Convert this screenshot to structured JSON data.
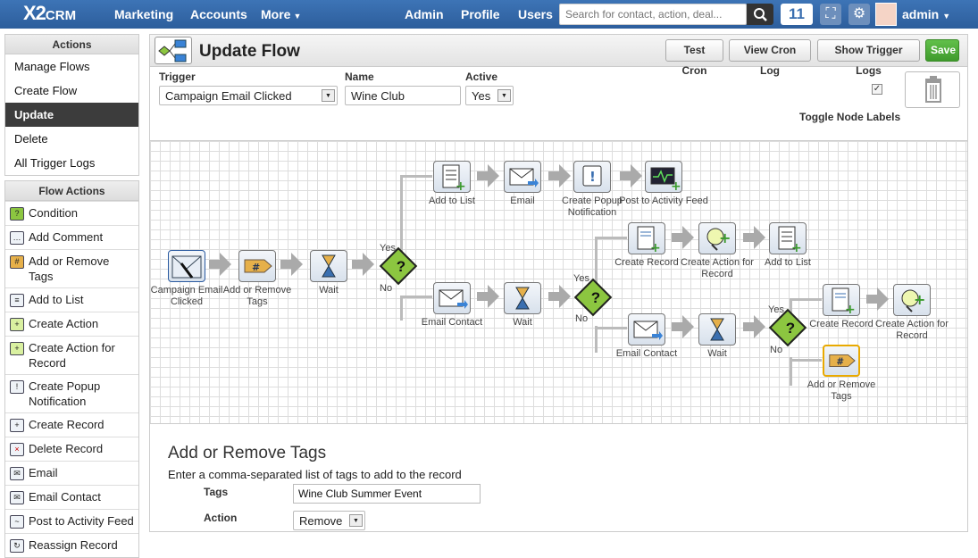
{
  "app": {
    "logo": "X2",
    "logo_suffix": "CRM"
  },
  "nav": {
    "marketing": "Marketing",
    "accounts": "Accounts",
    "more": "More",
    "admin": "Admin",
    "profile": "Profile",
    "users": "Users"
  },
  "search": {
    "placeholder": "Search for contact, action, deal..."
  },
  "notifications_count": "11",
  "user": {
    "name": "admin"
  },
  "sidebar": {
    "actions_title": "Actions",
    "actions": [
      "Manage Flows",
      "Create Flow",
      "Update",
      "Delete",
      "All Trigger Logs"
    ],
    "active_index": 2,
    "flow_actions_title": "Flow Actions",
    "flow_actions": [
      "Condition",
      "Add Comment",
      "Add or Remove Tags",
      "Add to List",
      "Create Action",
      "Create Action for Record",
      "Create Popup Notification",
      "Create Record",
      "Delete Record",
      "Email",
      "Email Contact",
      "Post to Activity Feed",
      "Reassign Record"
    ]
  },
  "page": {
    "title": "Update Flow",
    "buttons": {
      "test_cron": "Test Cron",
      "view_cron_log": "View Cron Log",
      "show_trigger_logs": "Show Trigger Logs",
      "save": "Save"
    }
  },
  "form": {
    "trigger_label": "Trigger",
    "trigger_value": "Campaign Email Clicked",
    "name_label": "Name",
    "name_value": "Wine Club",
    "active_label": "Active",
    "active_value": "Yes",
    "toggle_labels": "Toggle Node Labels",
    "toggle_checked": true
  },
  "flow": {
    "nodes": {
      "start": "Campaign Email Clicked",
      "tags1": "Add or Remove Tags",
      "wait1": "Wait",
      "add_list1": "Add to List",
      "email1": "Email",
      "popup": "Create Popup Notification",
      "post_feed": "Post to Activity Feed",
      "email_contact1": "Email Contact",
      "wait2": "Wait",
      "create_record1": "Create Record",
      "create_action1": "Create Action for Record",
      "add_list2": "Add to List",
      "email_contact2": "Email Contact",
      "wait3": "Wait",
      "create_record2": "Create Record",
      "create_action2": "Create Action for Record",
      "tags2": "Add or Remove Tags"
    },
    "yes": "Yes",
    "no": "No"
  },
  "details": {
    "title": "Add or Remove Tags",
    "description": "Enter a comma-separated list of tags to add to the record",
    "tags_label": "Tags",
    "tags_value": "Wine Club Summer Event",
    "action_label": "Action",
    "action_value": "Remove"
  },
  "colors": {
    "topbar": "#3566a8",
    "save": "#4caf38",
    "condition": "#8cc640",
    "selected": "#e9a900",
    "active_item": "#3c3c3c"
  }
}
